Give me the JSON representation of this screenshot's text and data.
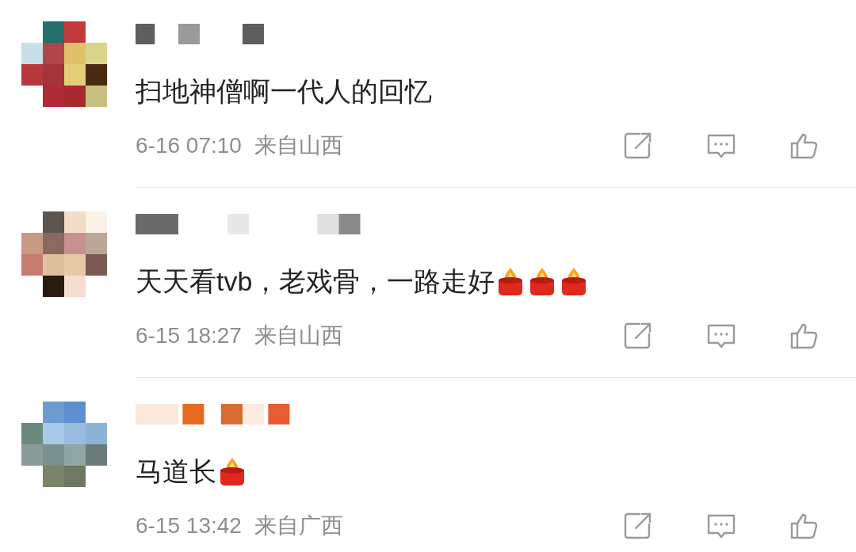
{
  "comments": [
    {
      "text": "扫地神僧啊一代人的回忆",
      "time": "6-16 07:10",
      "location": "来自山西"
    },
    {
      "text": "天天看tvb，老戏骨，一路走好",
      "emojis": [
        {
          "kind": "candle"
        },
        {
          "kind": "candle"
        },
        {
          "kind": "candle"
        }
      ],
      "time": "6-15 18:27",
      "location": "来自山西"
    },
    {
      "text": "马道长",
      "emojis": [
        {
          "kind": "candle"
        }
      ],
      "time": "6-15 13:42",
      "location": "来自广西"
    }
  ]
}
